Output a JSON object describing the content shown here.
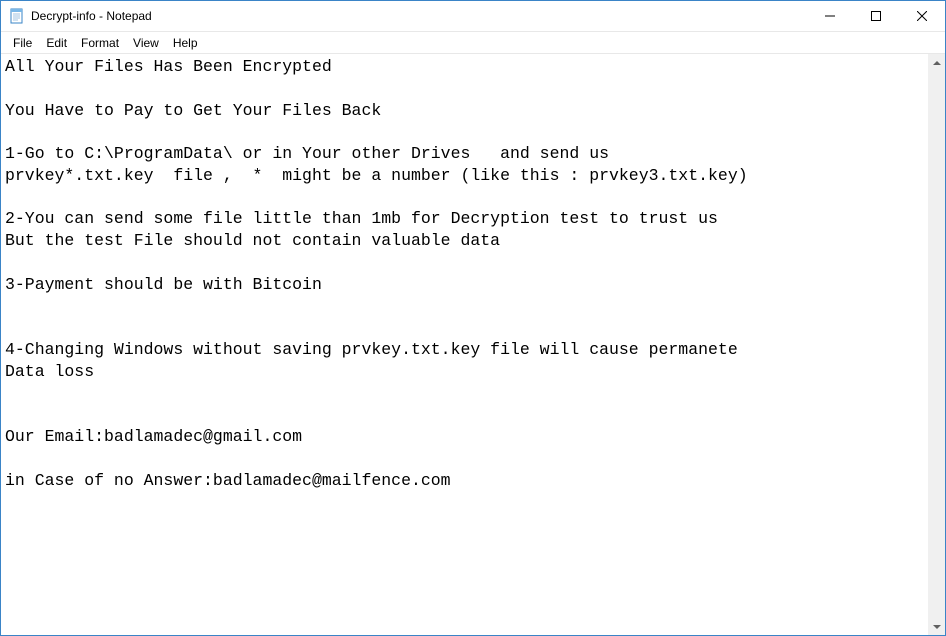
{
  "window": {
    "title": "Decrypt-info - Notepad"
  },
  "menu": {
    "file": "File",
    "edit": "Edit",
    "format": "Format",
    "view": "View",
    "help": "Help"
  },
  "document": {
    "text": "All Your Files Has Been Encrypted\n\nYou Have to Pay to Get Your Files Back\n\n1-Go to C:\\ProgramData\\ or in Your other Drives   and send us\nprvkey*.txt.key  file ,  *  might be a number (like this : prvkey3.txt.key)\n\n2-You can send some file little than 1mb for Decryption test to trust us\nBut the test File should not contain valuable data\n\n3-Payment should be with Bitcoin\n\n\n4-Changing Windows without saving prvkey.txt.key file will cause permanete\nData loss\n\n\nOur Email:badlamadec@gmail.com\n\nin Case of no Answer:badlamadec@mailfence.com"
  }
}
